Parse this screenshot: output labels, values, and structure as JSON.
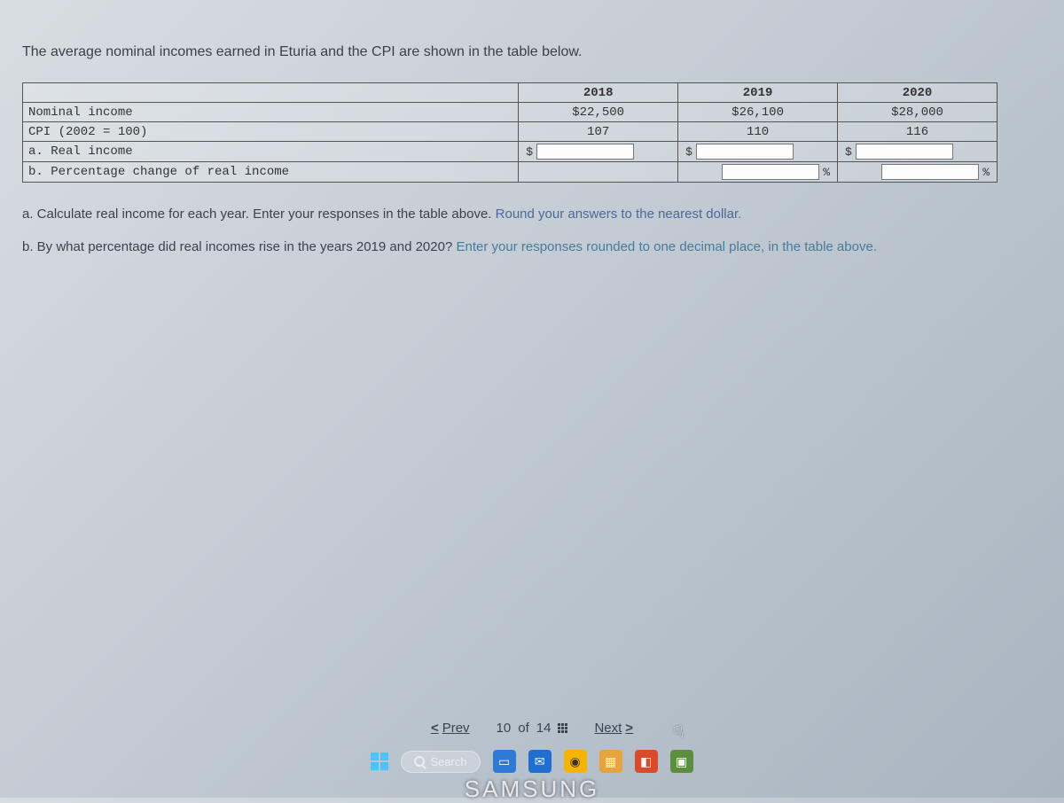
{
  "intro_text": "The average nominal incomes earned in Eturia and the CPI are shown in the table below.",
  "table": {
    "years": {
      "y2018": "2018",
      "y2019": "2019",
      "y2020": "2020"
    },
    "rows": {
      "nominal": {
        "label": "Nominal income",
        "v2018": "$22,500",
        "v2019": "$26,100",
        "v2020": "$28,000"
      },
      "cpi": {
        "label": "CPI (2002 = 100)",
        "v2018": "107",
        "v2019": "110",
        "v2020": "116"
      },
      "real": {
        "label": "a. Real income"
      },
      "pct": {
        "label": "b. Percentage change of real income"
      }
    },
    "prefix_dollar": "$",
    "suffix_percent": "%"
  },
  "questions": {
    "a_plain": "a. Calculate real income for each year. Enter your responses in the table above. ",
    "a_hint": "Round your answers to the nearest dollar.",
    "b_plain": "b. By what percentage did real incomes rise in the years 2019 and 2020? ",
    "b_hint": "Enter your responses rounded to one decimal place, in the table above."
  },
  "nav": {
    "prev": "Prev",
    "next": "Next",
    "page_current": "10",
    "page_of": "of",
    "page_total": "14",
    "chev_left": "<",
    "chev_right": ">"
  },
  "taskbar": {
    "search_placeholder": "Search"
  },
  "bezel": "SAMSUNG"
}
